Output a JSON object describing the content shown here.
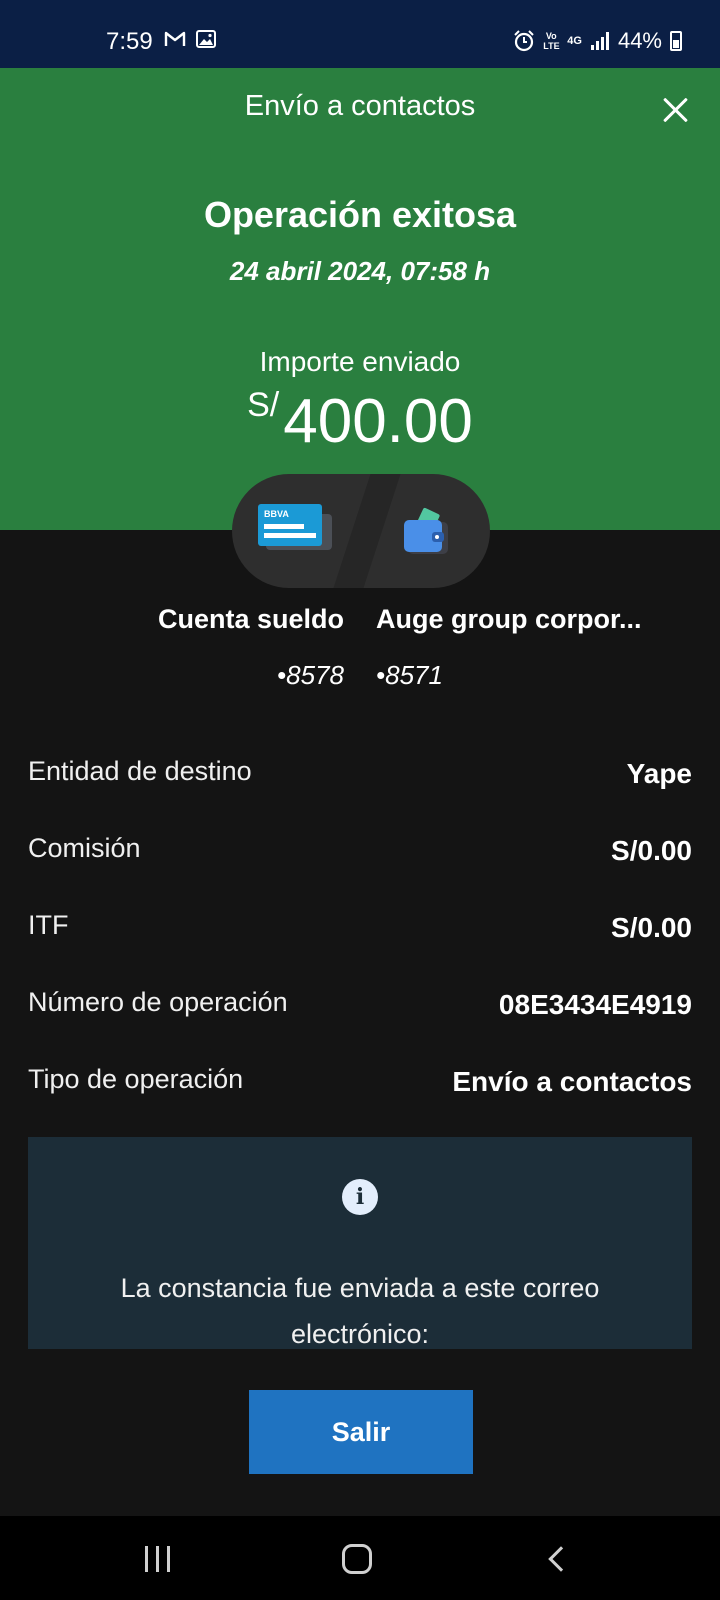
{
  "status_bar": {
    "time": "7:59",
    "battery": "44%",
    "left_icons": [
      "gmail-icon",
      "gallery-icon"
    ],
    "right_icons": [
      "alarm-icon",
      "volte-icon",
      "4g-icon",
      "signal-icon",
      "battery-icon"
    ],
    "volte_label": "Vo LTE",
    "network_label": "4G"
  },
  "header": {
    "title": "Envío a contactos",
    "status_title": "Operación exitosa",
    "datetime": "24 abril 2024, 07:58 h",
    "amount_label": "Importe enviado",
    "currency": "S/",
    "amount": "400.00",
    "background_color": "#2a7f3f"
  },
  "transfer": {
    "card_brand": "BBVA",
    "from": {
      "name": "Cuenta sueldo",
      "number": "•8578"
    },
    "to": {
      "name": "Auge group corpor...",
      "number": "•8571"
    }
  },
  "details": [
    {
      "label": "Entidad de destino",
      "value": "Yape"
    },
    {
      "label": "Comisión",
      "value": "S/0.00"
    },
    {
      "label": "ITF",
      "value": "S/0.00"
    },
    {
      "label": "Número de operación",
      "value": "08E3434E4919"
    },
    {
      "label": "Tipo de operación",
      "value": "Envío a contactos"
    }
  ],
  "info": {
    "icon": "info-icon",
    "text": "La constancia fue enviada a este correo electrónico:"
  },
  "actions": {
    "exit_label": "Salir",
    "accent_color": "#1f73c1"
  },
  "nav_bar": {
    "icons": [
      "recent-apps-icon",
      "home-icon",
      "back-icon"
    ]
  }
}
